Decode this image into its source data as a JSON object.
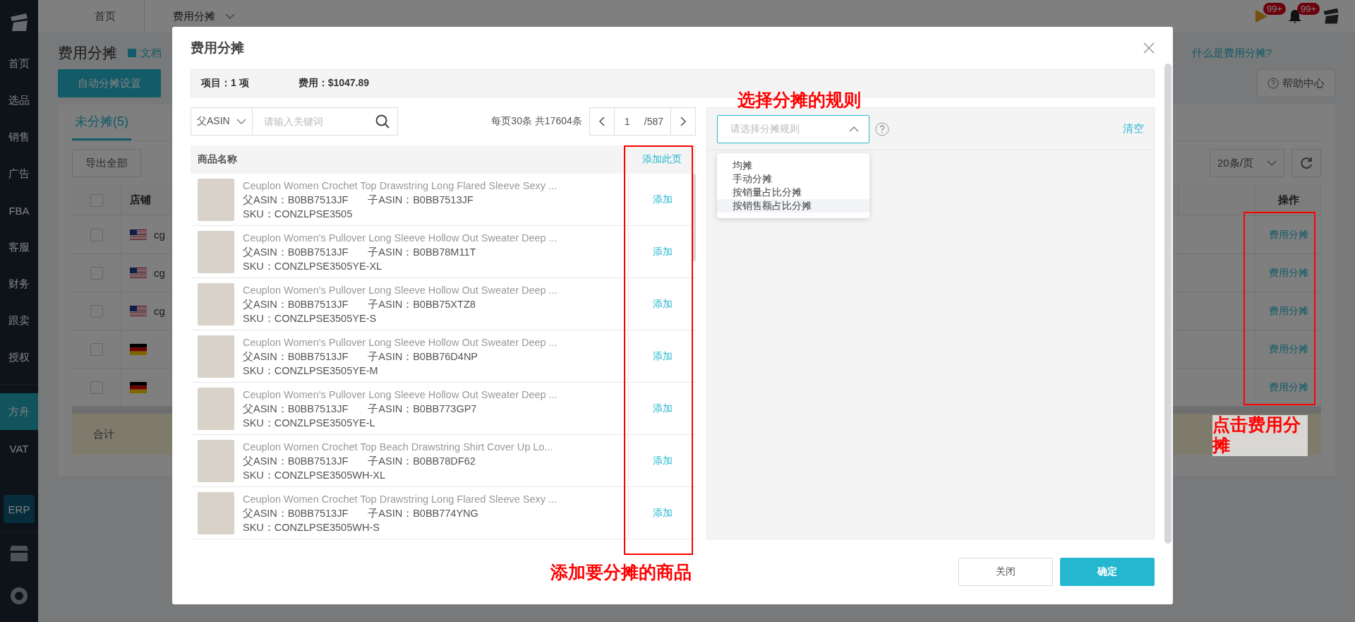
{
  "sidebar": {
    "items": [
      {
        "label": "首页",
        "selected": false
      },
      {
        "label": "选品",
        "selected": false
      },
      {
        "label": "销售",
        "selected": false
      },
      {
        "label": "广告",
        "selected": false
      },
      {
        "label": "FBA",
        "selected": false
      },
      {
        "label": "客服",
        "selected": false
      },
      {
        "label": "财务",
        "selected": false
      },
      {
        "label": "跟卖",
        "selected": false
      },
      {
        "label": "授权",
        "selected": false
      },
      {
        "label": "方舟",
        "selected": true
      },
      {
        "label": "VAT",
        "selected": false
      }
    ],
    "erp_badge": "ERP"
  },
  "top_bar": {
    "tabs": [
      {
        "label": "首页",
        "selected": false
      },
      {
        "label": "费用分摊",
        "selected": true
      }
    ],
    "flag_badge": "99+",
    "bell_badge": "99+"
  },
  "page": {
    "title": "费用分摊",
    "doc_link": "文档",
    "what_link": "什么是费用分摊?",
    "auto_button": "自动分摊设置",
    "help_button": "帮助中心",
    "tabs": [
      {
        "label": "未分摊(5)",
        "selected": true
      }
    ],
    "export_button": "导出全部",
    "page_size": "20条/页",
    "table": {
      "columns": [
        "店铺",
        "操作"
      ],
      "header_checked": false,
      "rows": [
        {
          "kind": "us",
          "checked": false,
          "store": "cg",
          "action": "费用分摊"
        },
        {
          "kind": "us",
          "checked": false,
          "store": "cg",
          "action": "费用分摊"
        },
        {
          "kind": "us",
          "checked": false,
          "store": "cg",
          "action": "费用分摊"
        },
        {
          "kind": "de",
          "checked": false,
          "action": "费用分摊"
        },
        {
          "kind": "de",
          "checked": false,
          "action": "费用分摊"
        }
      ],
      "total_label": "合计"
    }
  },
  "modal": {
    "title": "费用分摊",
    "summary": [
      "项目：1 项",
      "费用：$1047.89"
    ],
    "filter_select": "父ASIN",
    "search": {
      "placeholder": "请输入关键词"
    },
    "page_info": "每页30条 共17604条",
    "page": "1",
    "page_total": "/587",
    "columns": [
      "商品名称"
    ],
    "add_page": "添加此页",
    "products": [
      {
        "title": "Ceuplon Women Crochet Top Drawstring Long Flared Sleeve Sexy ...",
        "parent": "父ASIN：B0BB7513JF",
        "child": "子ASIN：B0BB7513JF",
        "sku": "SKU：CONZLPSE3505",
        "action": "添加"
      },
      {
        "title": "Ceuplon Women's Pullover Long Sleeve Hollow Out Sweater Deep ...",
        "parent": "父ASIN：B0BB7513JF",
        "child": "子ASIN：B0BB78M11T",
        "sku": "SKU：CONZLPSE3505YE-XL",
        "action": "添加"
      },
      {
        "title": "Ceuplon Women's Pullover Long Sleeve Hollow Out Sweater Deep ...",
        "parent": "父ASIN：B0BB7513JF",
        "child": "子ASIN：B0BB75XTZ8",
        "sku": "SKU：CONZLPSE3505YE-S",
        "action": "添加"
      },
      {
        "title": "Ceuplon Women's Pullover Long Sleeve Hollow Out Sweater Deep ...",
        "parent": "父ASIN：B0BB7513JF",
        "child": "子ASIN：B0BB76D4NP",
        "sku": "SKU：CONZLPSE3505YE-M",
        "action": "添加"
      },
      {
        "title": "Ceuplon Women's Pullover Long Sleeve Hollow Out Sweater Deep ...",
        "parent": "父ASIN：B0BB7513JF",
        "child": "子ASIN：B0BB773GP7",
        "sku": "SKU：CONZLPSE3505YE-L",
        "action": "添加"
      },
      {
        "title": "Ceuplon Women Crochet Top Beach Drawstring Shirt Cover Up Lo...",
        "parent": "父ASIN：B0BB7513JF",
        "child": "子ASIN：B0BB78DF62",
        "sku": "SKU：CONZLPSE3505WH-XL",
        "action": "添加"
      },
      {
        "title": "Ceuplon Women Crochet Top Drawstring Long Flared Sleeve Sexy ...",
        "parent": "父ASIN：B0BB7513JF",
        "child": "子ASIN：B0BB774YNG",
        "sku": "SKU：CONZLPSE3505WH-S",
        "action": "添加"
      }
    ],
    "rule_select": {
      "placeholder": "请选择分摊规则",
      "expanded": true,
      "options": [
        {
          "label": "均摊",
          "highlighted": false
        },
        {
          "label": "手动分摊",
          "highlighted": false
        },
        {
          "label": "按销量占比分摊",
          "highlighted": false
        },
        {
          "label": "按销售额占比分摊",
          "highlighted": true
        }
      ]
    },
    "clear_link": "清空",
    "buttons": {
      "cancel": "关闭",
      "confirm": "确定"
    }
  },
  "annotations": {
    "rule_note": "选择分摊的规则",
    "add_note": "添加要分摊的商品",
    "click_note": "点击费用分摊"
  }
}
